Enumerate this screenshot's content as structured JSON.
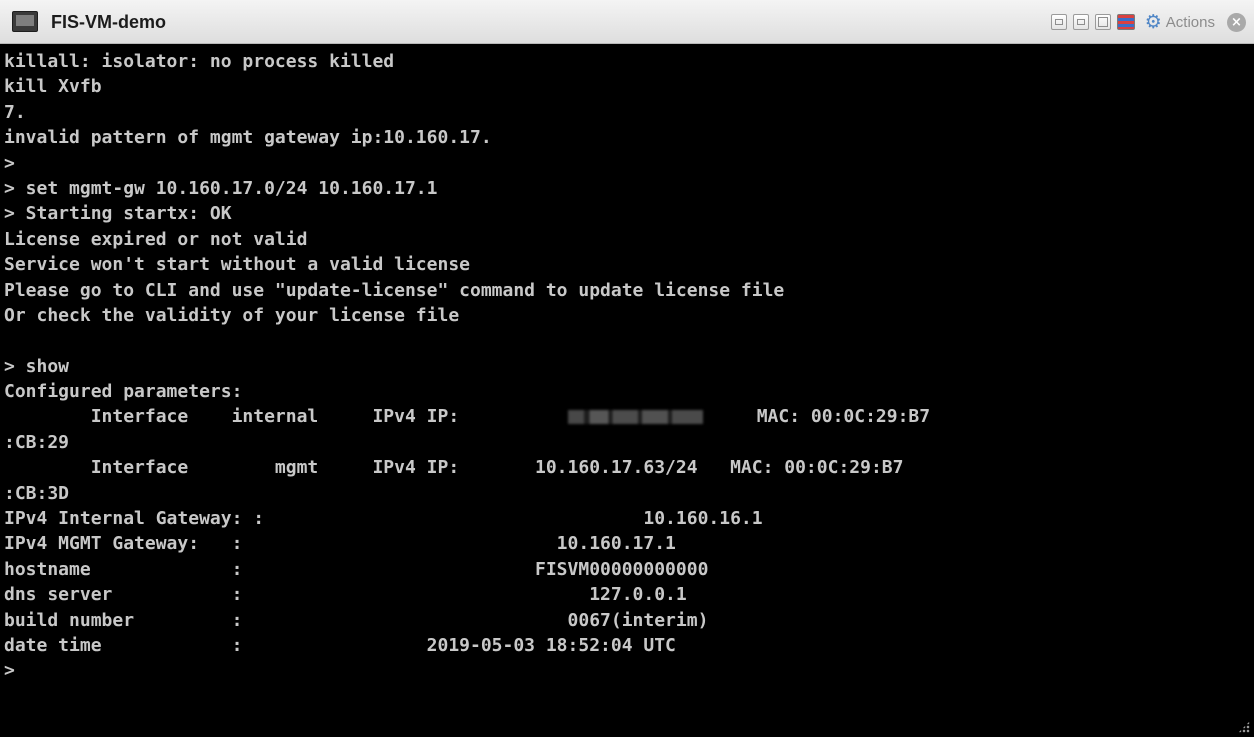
{
  "window": {
    "title": "FIS-VM-demo"
  },
  "toolbar": {
    "actions_label": "Actions",
    "icons": [
      "fit-window-icon",
      "restore-icon",
      "fullscreen-icon",
      "keyboard-icon",
      "gear-icon",
      "close-icon"
    ]
  },
  "console": {
    "lines": [
      "killall: isolator: no process killed",
      "kill Xvfb",
      "7.",
      "invalid pattern of mgmt gateway ip:10.160.17.",
      ">",
      "> set mgmt-gw 10.160.17.0/24 10.160.17.1",
      "> Starting startx: OK",
      "License expired or not valid",
      "Service won't start without a valid license",
      "Please go to CLI and use \"update-license\" command to update license file",
      "Or check the validity of your license file",
      "",
      "> show",
      "Configured parameters:"
    ],
    "interface_internal": {
      "prefix": "        Interface    internal     IPv4 IP:          ",
      "suffix": "     MAC: 00:0C:29:B7"
    },
    "interface_internal_cont": ":CB:29",
    "interface_mgmt": "        Interface        mgmt     IPv4 IP:       10.160.17.63/24   MAC: 00:0C:29:B7",
    "interface_mgmt_cont": ":CB:3D",
    "tail_lines": [
      "IPv4 Internal Gateway: :                                   10.160.16.1",
      "IPv4 MGMT Gateway:   :                             10.160.17.1",
      "hostname             :                           FISVM00000000000",
      "dns server           :                                127.0.0.1",
      "build number         :                              0067(interim)",
      "date time            :                 2019-05-03 18:52:04 UTC",
      ">"
    ]
  }
}
